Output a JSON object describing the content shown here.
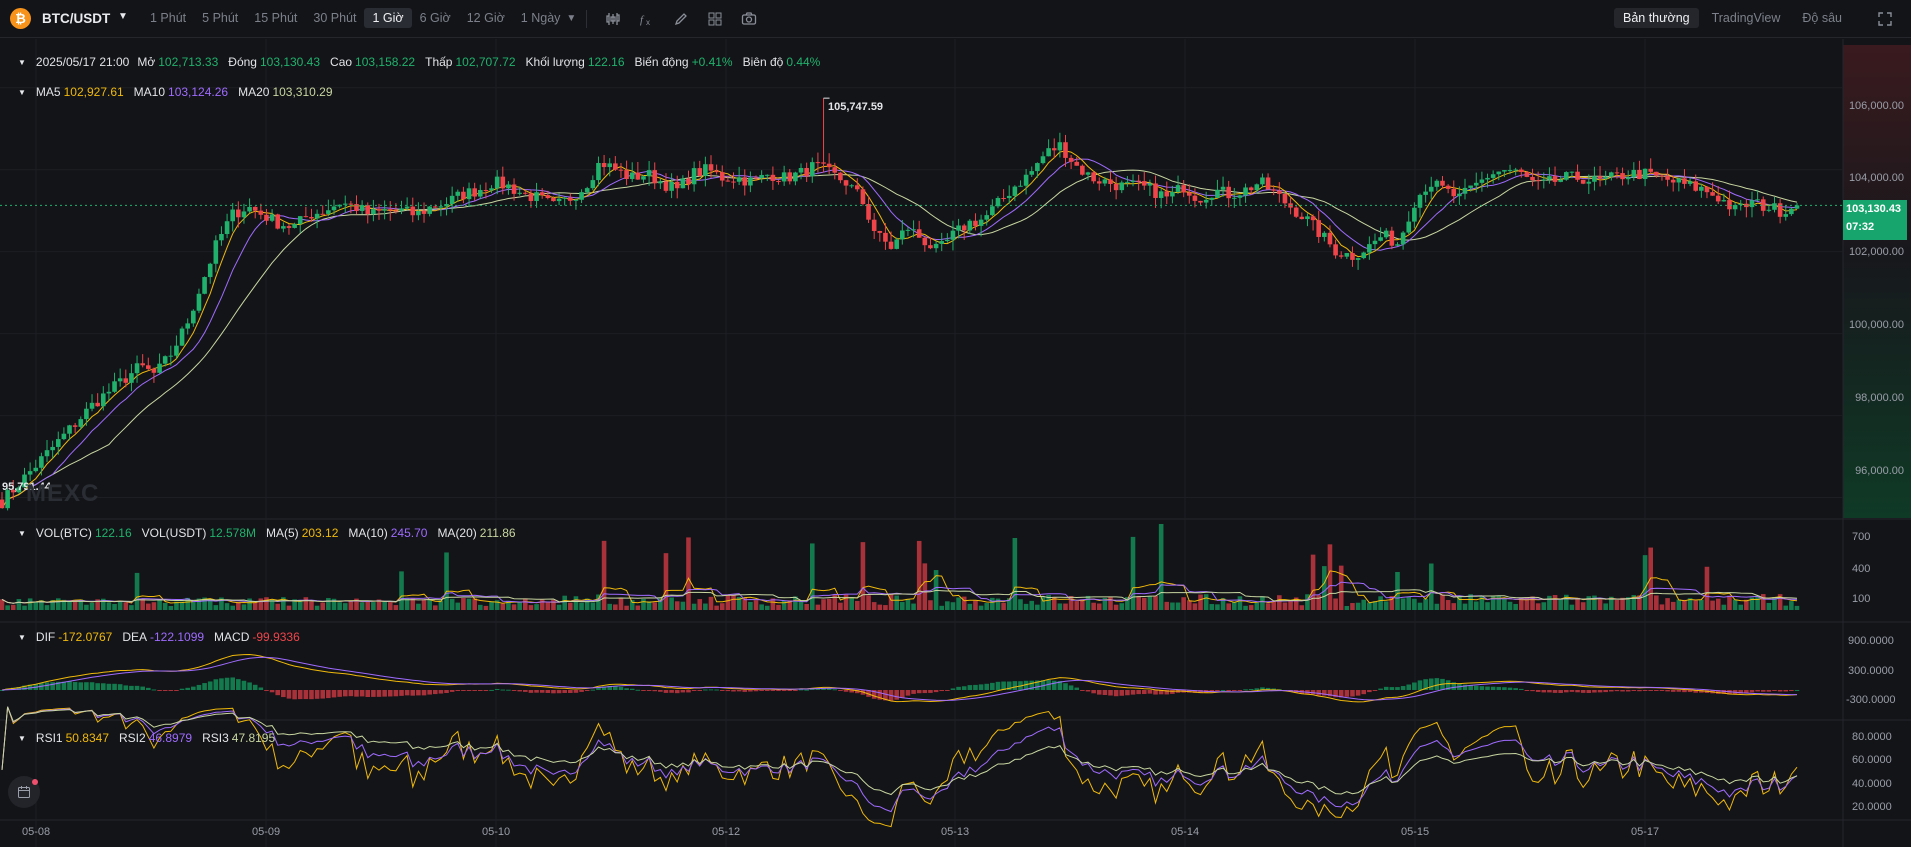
{
  "header": {
    "coin_icon": "bitcoin-icon",
    "coin_glyph": "₿",
    "pair": "BTC/USDT",
    "intervals": [
      "1 Phút",
      "5 Phút",
      "15 Phút",
      "30 Phút",
      "1 Giờ",
      "6 Giờ",
      "12 Giờ",
      "1 Ngày"
    ],
    "active_interval": "1 Giờ",
    "tools": [
      "candle-settings-icon",
      "indicator-fx-icon",
      "draw-pencil-icon",
      "layout-grid-icon",
      "camera-icon"
    ],
    "views": [
      "Bản thường",
      "TradingView",
      "Độ sâu"
    ],
    "active_view": "Bản thường",
    "fullscreen_icon": "fullscreen-icon"
  },
  "ohlc": {
    "date": "2025/05/17 21:00",
    "open_label": "Mở",
    "open": "102,713.33",
    "close_label": "Đóng",
    "close": "103,130.43",
    "high_label": "Cao",
    "high": "103,158.22",
    "low_label": "Thấp",
    "low": "102,707.72",
    "volume_label": "Khối lượng",
    "volume": "122.16",
    "change_label": "Biến động",
    "change": "+0.41%",
    "amplitude_label": "Biên độ",
    "amplitude": "0.44%"
  },
  "ma": {
    "ma5_label": "MA5",
    "ma5": "102,927.61",
    "ma10_label": "MA10",
    "ma10": "103,124.26",
    "ma20_label": "MA20",
    "ma20": "103,310.29"
  },
  "vol": {
    "btc_label": "VOL(BTC)",
    "btc": "122.16",
    "usdt_label": "VOL(USDT)",
    "usdt": "12.578M",
    "ma5_label": "MA(5)",
    "ma5": "203.12",
    "ma10_label": "MA(10)",
    "ma10": "245.70",
    "ma20_label": "MA(20)",
    "ma20": "211.86"
  },
  "macd": {
    "dif_label": "DIF",
    "dif": "-172.0767",
    "dea_label": "DEA",
    "dea": "-122.1099",
    "macd_label": "MACD",
    "macd": "-99.9336"
  },
  "rsi": {
    "rsi1_label": "RSI1",
    "rsi1": "50.8347",
    "rsi2_label": "RSI2",
    "rsi2": "46.8979",
    "rsi3_label": "RSI3",
    "rsi3": "47.8195"
  },
  "price_axis": [
    "106,000.00",
    "104,000.00",
    "102,000.00",
    "100,000.00",
    "98,000.00",
    "96,000.00"
  ],
  "volume_axis": [
    "700",
    "400",
    "100"
  ],
  "macd_axis": [
    "900.0000",
    "300.0000",
    "-300.0000"
  ],
  "rsi_axis": [
    "80.0000",
    "60.0000",
    "40.0000",
    "20.0000"
  ],
  "date_axis": [
    "05-08",
    "05-09",
    "05-10",
    "05-12",
    "05-13",
    "05-14",
    "05-15",
    "05-17"
  ],
  "last_price": "103,130.43",
  "countdown": "07:32",
  "high_marker": "105,747.59",
  "low_marker": "95,791.44",
  "watermark": "MEXC",
  "colors": {
    "up": "#20b26c",
    "down": "#ef454a",
    "ma5": "#f0b90b",
    "ma10": "#9f6bff",
    "ma20": "#c8d6a0"
  },
  "chart_data": {
    "type": "candlestick",
    "title": "",
    "x_labels": [
      "05-08",
      "05-09",
      "05-10",
      "05-12",
      "05-13",
      "05-14",
      "05-15",
      "05-17"
    ],
    "price_range": [
      95500,
      106800
    ],
    "close_path": [
      95900,
      96300,
      96700,
      97100,
      97500,
      97900,
      98300,
      98600,
      98900,
      99200,
      99000,
      99500,
      100200,
      101200,
      102200,
      102900,
      103100,
      102900,
      102700,
      102600,
      102900,
      103000,
      103200,
      103100,
      102900,
      103000,
      103000,
      102900,
      103100,
      103200,
      103400,
      103500,
      103700,
      103600,
      103400,
      103300,
      103100,
      103300,
      103600,
      104200,
      104000,
      103800,
      103900,
      103700,
      103500,
      103900,
      104000,
      103800,
      103800,
      103700,
      103900,
      103800,
      103900,
      104100,
      103900,
      103700,
      103300,
      102400,
      102100,
      102600,
      102300,
      102000,
      102400,
      102700,
      102800,
      103200,
      103600,
      103900,
      104400,
      104600,
      104100,
      103800,
      103700,
      103600,
      103600,
      103500,
      103300,
      103600,
      103300,
      103500,
      103400,
      103500,
      103700,
      103400,
      103100,
      102800,
      102400,
      102000,
      101900,
      102100,
      102400,
      102200,
      103200,
      103700,
      103500,
      103300,
      103600,
      103900,
      104000,
      103900,
      103600,
      103700,
      103800,
      103800,
      103700,
      103800,
      103900,
      103900,
      103800,
      103700,
      103600,
      103500,
      103300,
      103000,
      103200,
      103100,
      103000,
      103130
    ]
  }
}
